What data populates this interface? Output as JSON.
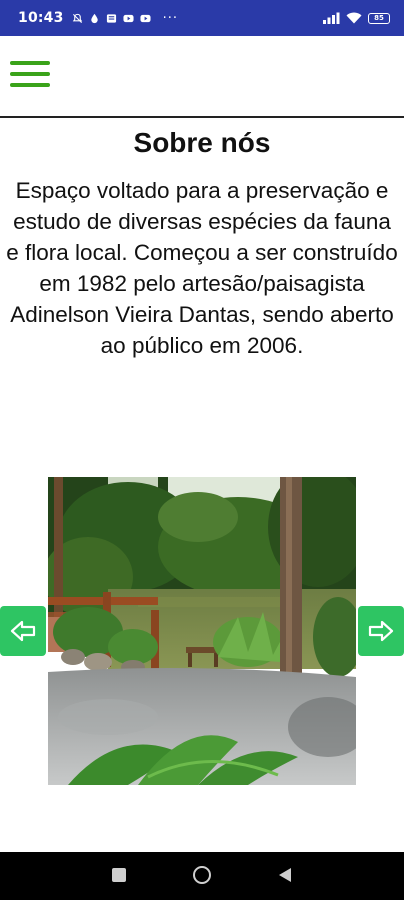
{
  "status_bar": {
    "time": "10:43",
    "more": "···",
    "battery": "85",
    "icons": [
      "notification-muted-icon",
      "water-drop-icon",
      "gallery-icon",
      "youtube-icon",
      "youtube-icon",
      "signal-icon",
      "wifi-icon",
      "battery-icon"
    ]
  },
  "header": {
    "menu_icon": "hamburger-menu-icon",
    "accent_color": "#3aa31a"
  },
  "content": {
    "title": "Sobre nós",
    "description": "Espaço voltado para a preservação e estudo de diversas espécies da fauna e flora local. Começou a ser construído em 1982 pelo artesão/paisagista Adinelson Vieira Dantas, sendo aberto ao público em 2006."
  },
  "gallery": {
    "prev_icon": "arrow-left-icon",
    "next_icon": "arrow-right-icon",
    "button_color": "#2ec563"
  },
  "system_nav": {
    "icons": [
      "recents-square-icon",
      "home-circle-icon",
      "back-triangle-icon"
    ]
  }
}
